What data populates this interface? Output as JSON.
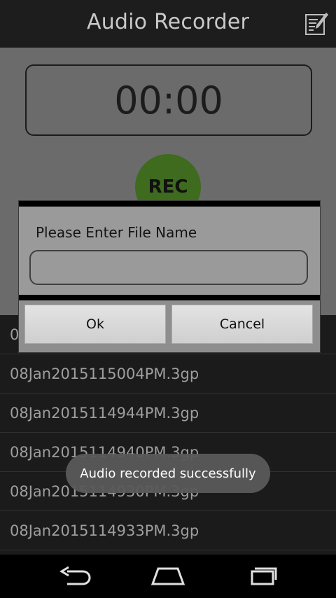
{
  "app": {
    "title": "Audio Recorder"
  },
  "timer": {
    "display": "00:00"
  },
  "recorder": {
    "rec_label": "REC",
    "rec_color": "#3e6b1e"
  },
  "recordings": [
    {
      "filename": "0"
    },
    {
      "filename": "08Jan2015115004PM.3gp"
    },
    {
      "filename": "08Jan2015114944PM.3gp"
    },
    {
      "filename": "08Jan2015114940PM.3gp"
    },
    {
      "filename": "08Jan2015114930PM.3gp"
    },
    {
      "filename": "08Jan2015114933PM.3gp"
    }
  ],
  "dialog": {
    "prompt": "Please Enter File Name",
    "input_value": "",
    "ok_label": "Ok",
    "cancel_label": "Cancel"
  },
  "toast": {
    "message": "Audio recorded successfully"
  },
  "icons": {
    "edit": "edit-note-icon",
    "back": "back-icon",
    "home": "home-icon",
    "recents": "recents-icon"
  }
}
